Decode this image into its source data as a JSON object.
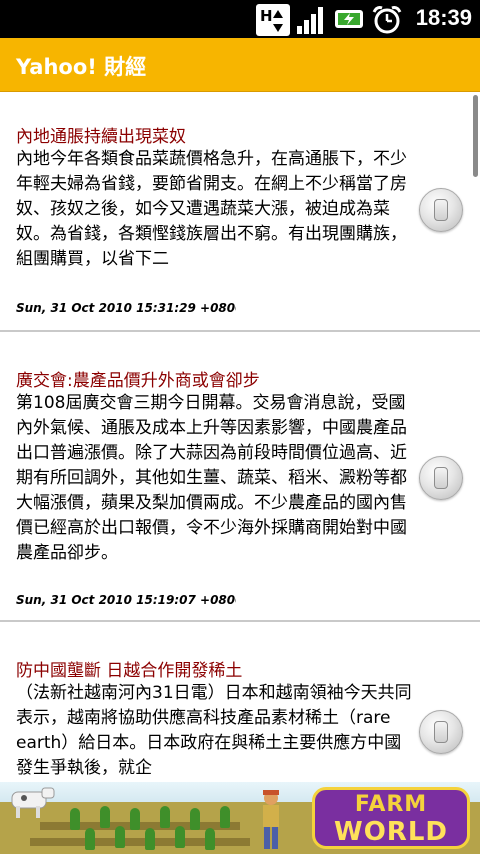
{
  "status_bar": {
    "time": "18:39",
    "network_label": "H",
    "icons": [
      "data-network-icon",
      "signal-strength-icon",
      "battery-charging-icon",
      "alarm-clock-icon"
    ]
  },
  "app": {
    "title": "Yahoo! 財經",
    "accent_color": "#f7b500",
    "headline_color": "#8b0000"
  },
  "articles": [
    {
      "headline": "內地通脹持續出現菜奴",
      "body": "內地今年各類食品菜蔬價格急升，在高通脹下，不少年輕夫婦為省錢，要節省開支。在網上不少稱當了房奴、孩奴之後，如今又遭遇蔬菜大漲，被迫成為菜奴。為省錢，各類慳錢族層出不窮。有出現團購族，組團購買，以省下二",
      "date": "Sun, 31 Oct 2010 15:31:29 +0800"
    },
    {
      "headline": "廣交會:農產品價升外商或會卻步",
      "body": "第108屆廣交會三期今日開幕。交易會消息說，受國內外氣候、通脹及成本上升等因素影響，中國農產品出口普遍漲價。除了大蒜因為前段時間價位過高、近期有所回調外，其他如生薑、蔬菜、稻米、澱粉等都大幅漲價，蘋果及梨加價兩成。不少農產品的國內售價已經高於出口報價，令不少海外採購商開始對中國農產品卻步。",
      "date": "Sun, 31 Oct 2010 15:19:07 +0800"
    },
    {
      "headline": "防中國壟斷 日越合作開發稀土",
      "body": "（法新社越南河內31日電）日本和越南領袖今天共同表示，越南將協助供應高科技產品素材稀土（rare earth）給日本。日本政府在與稀土主要供應方中國發生爭執後，就企",
      "date": ""
    }
  ],
  "ad": {
    "logo_line1": "FARM",
    "logo_line2": "WORLD"
  }
}
